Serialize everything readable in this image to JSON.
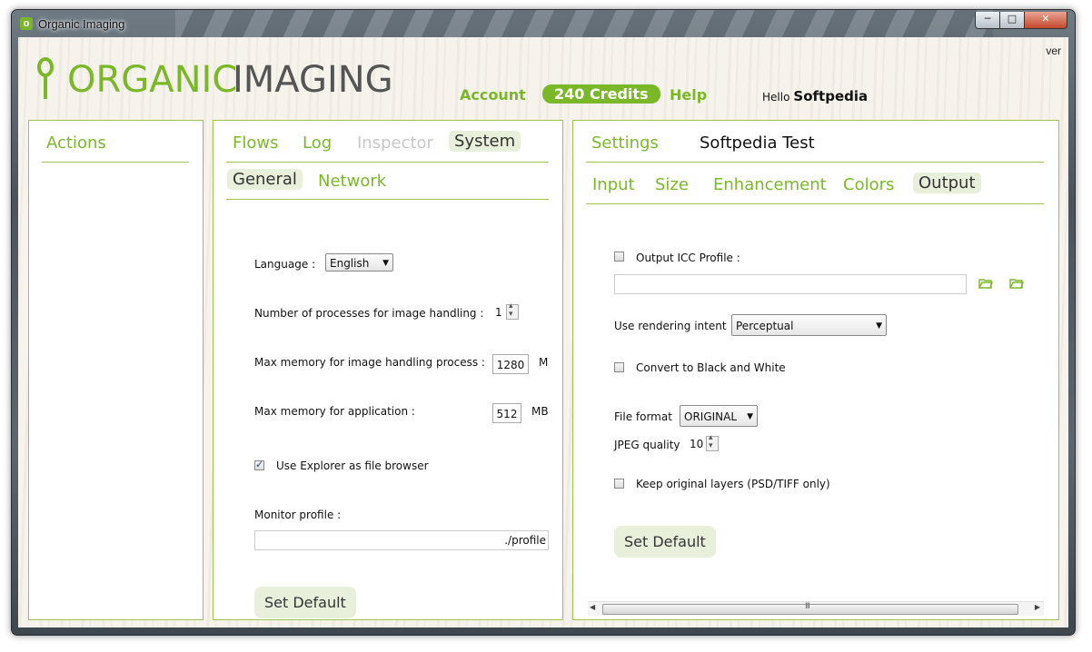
{
  "window": {
    "title": "Organic Imaging",
    "min_label": "─",
    "max_label": "□",
    "close_label": "✕",
    "version_label": "ver"
  },
  "logo": {
    "word1": "ORGANIC",
    "word2": "IMAGING"
  },
  "topnav": {
    "account": "Account",
    "credits": "240 Credits",
    "help": "Help",
    "hello": "Hello",
    "user": "Softpedia"
  },
  "actions": {
    "title": "Actions"
  },
  "system": {
    "tabs": [
      "Flows",
      "Log",
      "Inspector",
      "System"
    ],
    "subtabs": [
      "General",
      "Network"
    ],
    "language_label": "Language :",
    "language_value": "English",
    "processes_label": "Number of processes for image handling :",
    "processes_value": "1",
    "max_mem_process_label": "Max memory for image handling process :",
    "max_mem_process_value": "1280",
    "max_mem_process_unit": "M",
    "max_mem_app_label": "Max memory for application :",
    "max_mem_app_value": "512",
    "max_mem_app_unit": "MB",
    "explorer_label": "Use Explorer as file browser",
    "explorer_checked": true,
    "monitor_label": "Monitor profile :",
    "monitor_value": "./profile",
    "set_default": "Set Default"
  },
  "settings": {
    "title": "Settings",
    "preset_name": "Softpedia Test",
    "tabs": [
      "Input",
      "Size",
      "Enhancement",
      "Colors",
      "Output"
    ],
    "icc_label": "Output ICC Profile :",
    "icc_checked": false,
    "icc_value": "",
    "rendering_label": "Use rendering intent",
    "rendering_value": "Perceptual",
    "bw_label": "Convert to Black and White",
    "bw_checked": false,
    "format_label": "File format",
    "format_value": "ORIGINAL",
    "jpeg_label": "JPEG quality",
    "jpeg_value": "10",
    "layers_label": "Keep original layers (PSD/TIFF only)",
    "layers_checked": false,
    "set_default": "Set Default",
    "scroll_grip": "III"
  },
  "colors": {
    "accent": "#7ab829",
    "tab_active_bg": "#e8f0dc",
    "panel_border": "#9cc54a"
  }
}
